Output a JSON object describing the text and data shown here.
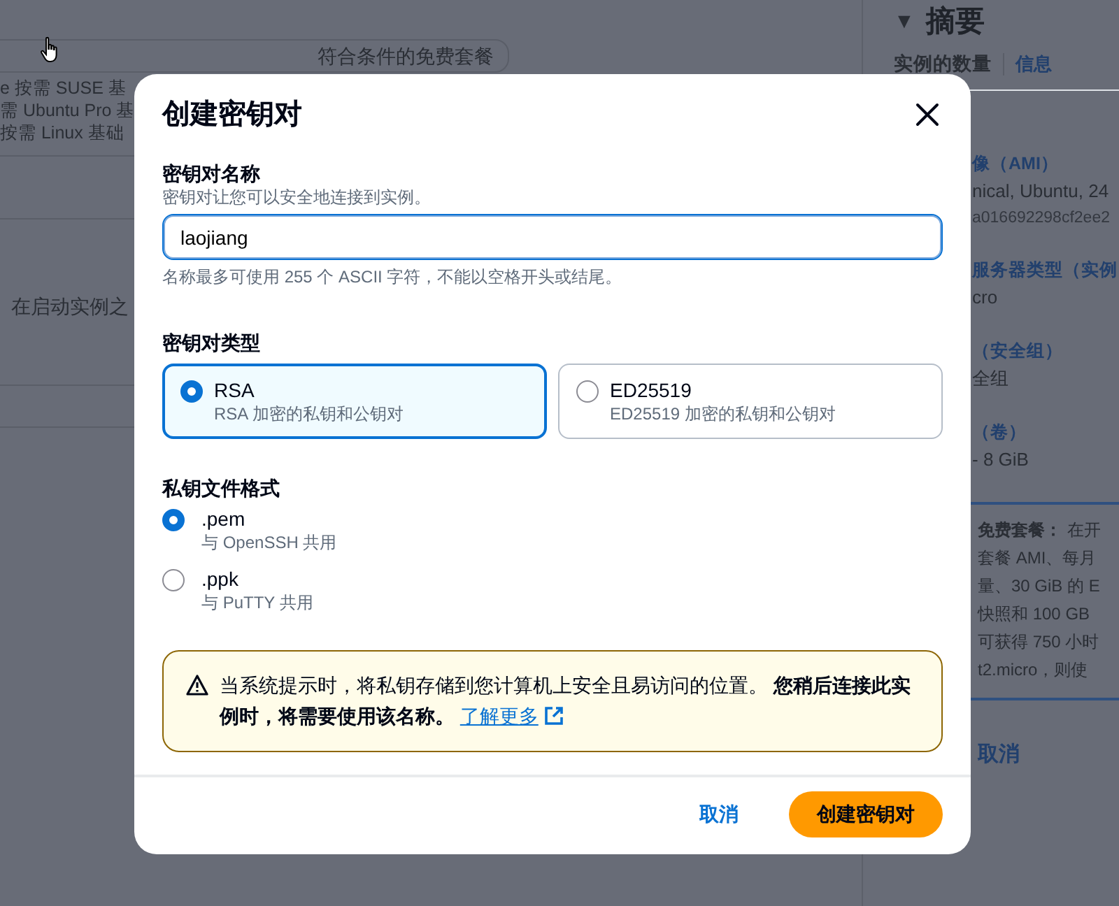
{
  "background": {
    "left": {
      "offer_field": "符合条件的免费套餐",
      "lines": [
        "e   按需 SUSE 基",
        "需 Ubuntu Pro 基",
        "按需 Linux 基础"
      ],
      "note": "在启动实例之"
    },
    "summary": {
      "toggle": "▼",
      "title": "摘要",
      "count_label": "实例的数量",
      "info_link": "信息",
      "items": [
        {
          "kind": "heading",
          "text": "像（AMI）"
        },
        {
          "kind": "value",
          "text": "nical, Ubuntu, 24"
        },
        {
          "kind": "detail",
          "text": "a016692298cf2ee2"
        },
        {
          "kind": "heading",
          "text": "服务器类型（实例"
        },
        {
          "kind": "value",
          "text": "cro"
        },
        {
          "kind": "heading",
          "text": "（安全组）"
        },
        {
          "kind": "value",
          "text": "全组"
        },
        {
          "kind": "heading",
          "text": "（卷）"
        },
        {
          "kind": "value",
          "text": "- 8 GiB"
        }
      ],
      "free_tier": {
        "label": "免费套餐：",
        "lines": [
          "在开",
          "套餐 AMI、每月",
          "量、30 GiB 的 E",
          "快照和 100 GB",
          "可获得 750 小时",
          "t2.micro，则使"
        ]
      },
      "cancel": "取消"
    }
  },
  "dialog": {
    "title": "创建密钥对",
    "name_field": {
      "label": "密钥对名称",
      "description": "密钥对让您可以安全地连接到实例。",
      "value": "laojiang",
      "hint": "名称最多可使用 255 个 ASCII 字符，不能以空格开头或结尾。"
    },
    "type_group": {
      "label": "密钥对类型",
      "options": [
        {
          "label": "RSA",
          "description": "RSA 加密的私钥和公钥对",
          "selected": true
        },
        {
          "label": "ED25519",
          "description": "ED25519 加密的私钥和公钥对",
          "selected": false
        }
      ]
    },
    "format_group": {
      "label": "私钥文件格式",
      "options": [
        {
          "label": ".pem",
          "description": "与 OpenSSH 共用",
          "selected": true
        },
        {
          "label": ".ppk",
          "description": "与 PuTTY 共用",
          "selected": false
        }
      ]
    },
    "warning": {
      "text": "当系统提示时，将私钥存储到您计算机上安全且易访问的位置。 **您稍后连接此实例时，将需要使用该名称。** ",
      "link": "了解更多"
    },
    "buttons": [
      {
        "kind": "secondary",
        "label": "取消"
      },
      {
        "kind": "primary",
        "label": "创建密钥对"
      }
    ]
  }
}
